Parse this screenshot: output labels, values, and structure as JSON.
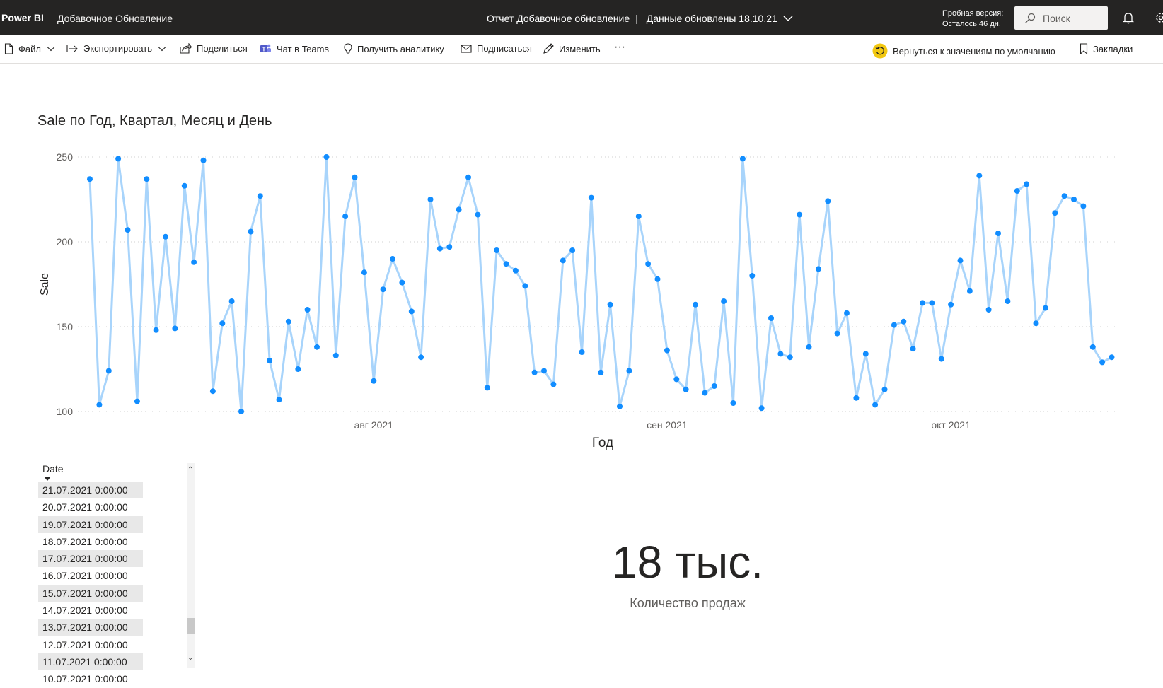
{
  "topbar": {
    "brand": "Power BI",
    "workspace": "Добавочное Обновление",
    "report": "Отчет Добавочное обновление",
    "separator": "|",
    "data_updated": "Данные обновлены 18.10.21",
    "trial_line1": "Пробная версия:",
    "trial_line2": "Осталось 46 дн.",
    "search_placeholder": "Поиск"
  },
  "toolbar": {
    "file": "Файл",
    "export": "Экспортировать",
    "share": "Поделиться",
    "teams": "Чат в Teams",
    "insights": "Получить аналитику",
    "subscribe": "Подписаться",
    "edit": "Изменить",
    "more": "···",
    "reset": "Вернуться к значениям по умолчанию",
    "bookmarks": "Закладки"
  },
  "chart_data": {
    "type": "line",
    "title": "Sale по Год, Квартал, Месяц и День",
    "xlabel": "Год",
    "ylabel": "Sale",
    "ylim": [
      100,
      250
    ],
    "yticks": [
      100,
      150,
      200,
      250
    ],
    "x_tick_labels": [
      {
        "label": "авг 2021",
        "index": 30
      },
      {
        "label": "сен 2021",
        "index": 61
      },
      {
        "label": "окт 2021",
        "index": 91
      }
    ],
    "grid": true,
    "series": [
      {
        "values": [
          237,
          104,
          124,
          249,
          207,
          106,
          237,
          148,
          203,
          149,
          233,
          188,
          248,
          112,
          152,
          165,
          100,
          206,
          227,
          130,
          107,
          153,
          125,
          160,
          138,
          250,
          133,
          215,
          238,
          182,
          118,
          172,
          190,
          176,
          159,
          132,
          225,
          196,
          197,
          219,
          238,
          216,
          114,
          195,
          187,
          183,
          174,
          123,
          124,
          116,
          189,
          195,
          135,
          226,
          123,
          163,
          103,
          124,
          215,
          187,
          178,
          136,
          119,
          113,
          163,
          111,
          115,
          165,
          105,
          249,
          180,
          102,
          155,
          134,
          132,
          216,
          138,
          184,
          224,
          146,
          158,
          108,
          134,
          104,
          113,
          151,
          153,
          137,
          164,
          164,
          131,
          163,
          189,
          171,
          239,
          160,
          205,
          165,
          230,
          234,
          152,
          161,
          217,
          227,
          225,
          221,
          138,
          129,
          132
        ]
      }
    ],
    "colors": {
      "line": "#a8d4fb",
      "marker": "#118dff",
      "grid": "#d0d0d0"
    }
  },
  "slicer": {
    "header": "Date",
    "items": [
      "21.07.2021 0:00:00",
      "20.07.2021 0:00:00",
      "19.07.2021 0:00:00",
      "18.07.2021 0:00:00",
      "17.07.2021 0:00:00",
      "16.07.2021 0:00:00",
      "15.07.2021 0:00:00",
      "14.07.2021 0:00:00",
      "13.07.2021 0:00:00",
      "12.07.2021 0:00:00",
      "11.07.2021 0:00:00",
      "10.07.2021 0:00:00"
    ]
  },
  "card": {
    "value": "18 тыс.",
    "label": "Количество продаж"
  }
}
